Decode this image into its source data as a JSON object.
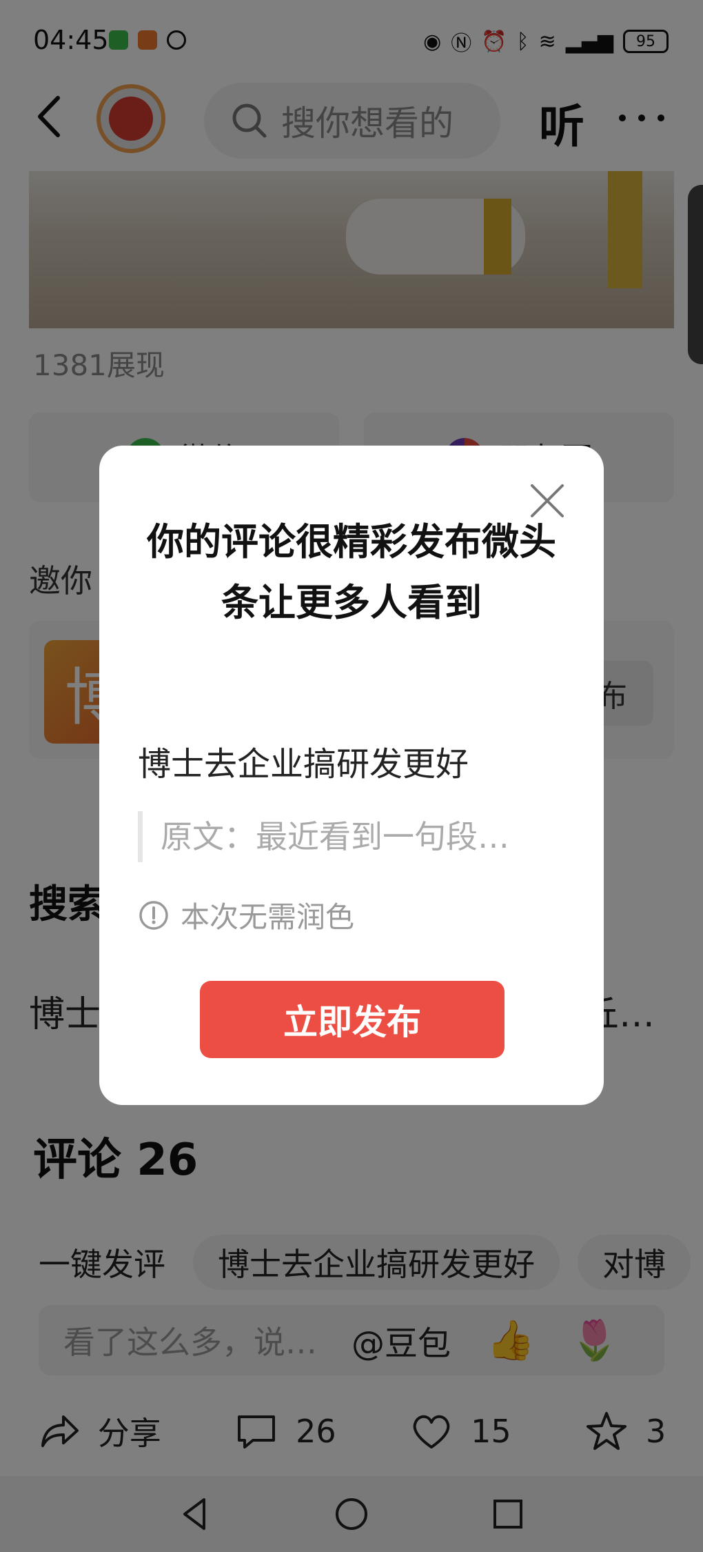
{
  "status_bar": {
    "time": "04:45",
    "battery": "95"
  },
  "top_nav": {
    "search_placeholder": "搜你想看的",
    "listen_label": "听"
  },
  "article": {
    "impressions": "1381展现",
    "share_tiles": [
      "微信",
      "朋友圈"
    ],
    "invite_label": "邀你",
    "invite_button": "布",
    "invite_thumb_char": "博",
    "search_section_title": "搜索",
    "search_row_left": "博士",
    "search_row_right": "丘…"
  },
  "comments": {
    "title": "评论 26",
    "chips": [
      "一键发评",
      "博士去企业搞研发更好",
      "对博"
    ],
    "input_placeholder": "看了这么多，说…",
    "doubao_label": "@豆包",
    "emoji_thumb": "👍",
    "emoji_flower": "🌷"
  },
  "actions": {
    "share_label": "分享",
    "comment_count": "26",
    "like_count": "15",
    "favorite_count": "3"
  },
  "modal": {
    "title": "你的评论很精彩发布微头条让更多人看到",
    "comment_text": "博士去企业搞研发更好",
    "quote_text": "原文：最近看到一句段…",
    "notice_text": "本次无需润色",
    "publish_button": "立即发布"
  },
  "colors": {
    "accent_red": "#ec4e44",
    "overlay": "rgba(0,0,0,0.5)"
  }
}
